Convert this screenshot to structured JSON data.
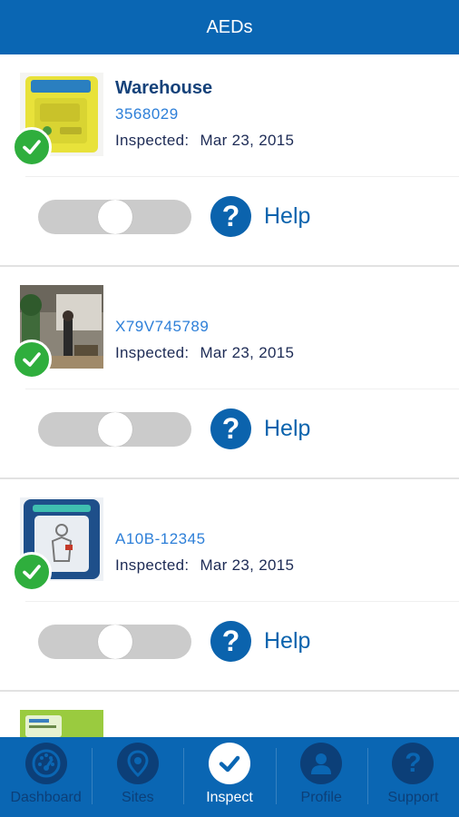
{
  "header": {
    "title": "AEDs"
  },
  "aeds": [
    {
      "name": "Warehouse",
      "serial": "3568029",
      "inspected_label": "Inspected:",
      "inspected_date": "Mar 23, 2015",
      "status": "ok",
      "help_label": "Help"
    },
    {
      "name": "",
      "serial": "X79V745789",
      "inspected_label": "Inspected:",
      "inspected_date": "Mar 23, 2015",
      "status": "ok",
      "help_label": "Help"
    },
    {
      "name": "",
      "serial": "A10B-12345",
      "inspected_label": "Inspected:",
      "inspected_date": "Mar 23, 2015",
      "status": "ok",
      "help_label": "Help"
    }
  ],
  "tabs": [
    {
      "label": "Dashboard",
      "icon": "dashboard-icon",
      "active": false
    },
    {
      "label": "Sites",
      "icon": "location-pin-icon",
      "active": false
    },
    {
      "label": "Inspect",
      "icon": "checkmark-icon",
      "active": true
    },
    {
      "label": "Profile",
      "icon": "person-icon",
      "active": false
    },
    {
      "label": "Support",
      "icon": "question-icon",
      "active": false
    }
  ],
  "colors": {
    "header_bg": "#0a66b3",
    "name_text": "#15427a",
    "serial_text": "#2d7fd8",
    "check_green": "#2fae3d",
    "toggle_off": "#cbcbcb",
    "help_blue": "#0b63ad",
    "tab_inactive": "#0c3f78"
  }
}
